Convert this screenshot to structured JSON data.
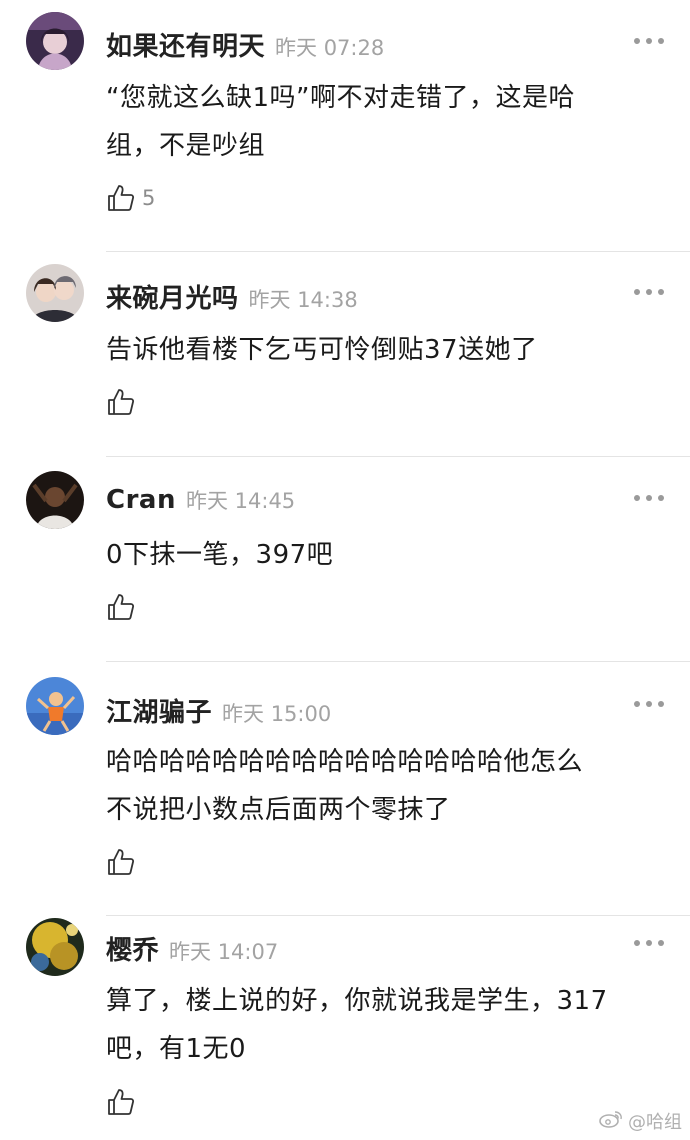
{
  "comments": [
    {
      "author": "如果还有明天",
      "date": "昨天 07:28",
      "text_lines": [
        "“您就这么缺1吗”啊不对走错了，这是哈",
        "组，不是吵组"
      ],
      "likes": "5"
    },
    {
      "author": "来碗月光吗",
      "date": "昨天 14:38",
      "text_lines": [
        "告诉他看楼下乞丐可怜倒贴37送她了"
      ],
      "likes": ""
    },
    {
      "author": "Cran",
      "date": "昨天 14:45",
      "text_lines": [
        "0下抹一笔，397吧"
      ],
      "likes": ""
    },
    {
      "author": "江湖骗子",
      "date": "昨天 15:00",
      "text_lines": [
        "哈哈哈哈哈哈哈哈哈哈哈哈哈哈哈他怎么",
        "不说把小数点后面两个零抹了"
      ],
      "likes": ""
    },
    {
      "author": "樱乔",
      "date": "昨天 14:07",
      "text_lines": [
        "算了，楼上说的好，你就说我是学生，317",
        "吧，有1无0"
      ],
      "likes": ""
    }
  ],
  "watermark": {
    "text": "@哈组",
    "icon": "weibo-logo-icon"
  }
}
